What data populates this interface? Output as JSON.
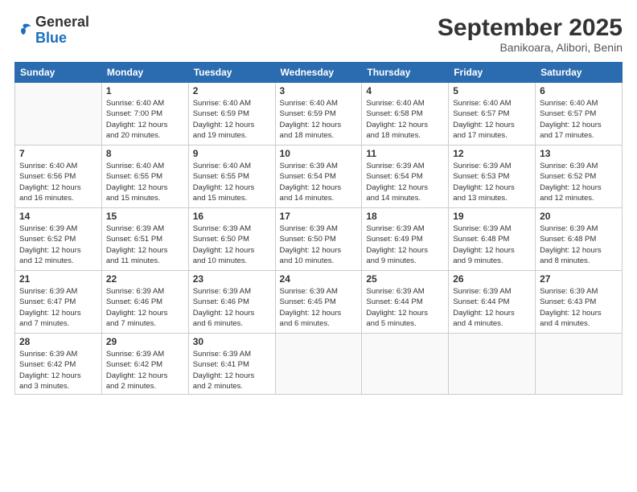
{
  "header": {
    "logo": {
      "line1": "General",
      "line2": "Blue"
    },
    "title": "September 2025",
    "location": "Banikoara, Alibori, Benin"
  },
  "calendar": {
    "days": [
      "Sunday",
      "Monday",
      "Tuesday",
      "Wednesday",
      "Thursday",
      "Friday",
      "Saturday"
    ],
    "weeks": [
      [
        {
          "day": "",
          "text": ""
        },
        {
          "day": "1",
          "text": "Sunrise: 6:40 AM\nSunset: 7:00 PM\nDaylight: 12 hours\nand 20 minutes."
        },
        {
          "day": "2",
          "text": "Sunrise: 6:40 AM\nSunset: 6:59 PM\nDaylight: 12 hours\nand 19 minutes."
        },
        {
          "day": "3",
          "text": "Sunrise: 6:40 AM\nSunset: 6:59 PM\nDaylight: 12 hours\nand 18 minutes."
        },
        {
          "day": "4",
          "text": "Sunrise: 6:40 AM\nSunset: 6:58 PM\nDaylight: 12 hours\nand 18 minutes."
        },
        {
          "day": "5",
          "text": "Sunrise: 6:40 AM\nSunset: 6:57 PM\nDaylight: 12 hours\nand 17 minutes."
        },
        {
          "day": "6",
          "text": "Sunrise: 6:40 AM\nSunset: 6:57 PM\nDaylight: 12 hours\nand 17 minutes."
        }
      ],
      [
        {
          "day": "7",
          "text": "Sunrise: 6:40 AM\nSunset: 6:56 PM\nDaylight: 12 hours\nand 16 minutes."
        },
        {
          "day": "8",
          "text": "Sunrise: 6:40 AM\nSunset: 6:55 PM\nDaylight: 12 hours\nand 15 minutes."
        },
        {
          "day": "9",
          "text": "Sunrise: 6:40 AM\nSunset: 6:55 PM\nDaylight: 12 hours\nand 15 minutes."
        },
        {
          "day": "10",
          "text": "Sunrise: 6:39 AM\nSunset: 6:54 PM\nDaylight: 12 hours\nand 14 minutes."
        },
        {
          "day": "11",
          "text": "Sunrise: 6:39 AM\nSunset: 6:54 PM\nDaylight: 12 hours\nand 14 minutes."
        },
        {
          "day": "12",
          "text": "Sunrise: 6:39 AM\nSunset: 6:53 PM\nDaylight: 12 hours\nand 13 minutes."
        },
        {
          "day": "13",
          "text": "Sunrise: 6:39 AM\nSunset: 6:52 PM\nDaylight: 12 hours\nand 12 minutes."
        }
      ],
      [
        {
          "day": "14",
          "text": "Sunrise: 6:39 AM\nSunset: 6:52 PM\nDaylight: 12 hours\nand 12 minutes."
        },
        {
          "day": "15",
          "text": "Sunrise: 6:39 AM\nSunset: 6:51 PM\nDaylight: 12 hours\nand 11 minutes."
        },
        {
          "day": "16",
          "text": "Sunrise: 6:39 AM\nSunset: 6:50 PM\nDaylight: 12 hours\nand 10 minutes."
        },
        {
          "day": "17",
          "text": "Sunrise: 6:39 AM\nSunset: 6:50 PM\nDaylight: 12 hours\nand 10 minutes."
        },
        {
          "day": "18",
          "text": "Sunrise: 6:39 AM\nSunset: 6:49 PM\nDaylight: 12 hours\nand 9 minutes."
        },
        {
          "day": "19",
          "text": "Sunrise: 6:39 AM\nSunset: 6:48 PM\nDaylight: 12 hours\nand 9 minutes."
        },
        {
          "day": "20",
          "text": "Sunrise: 6:39 AM\nSunset: 6:48 PM\nDaylight: 12 hours\nand 8 minutes."
        }
      ],
      [
        {
          "day": "21",
          "text": "Sunrise: 6:39 AM\nSunset: 6:47 PM\nDaylight: 12 hours\nand 7 minutes."
        },
        {
          "day": "22",
          "text": "Sunrise: 6:39 AM\nSunset: 6:46 PM\nDaylight: 12 hours\nand 7 minutes."
        },
        {
          "day": "23",
          "text": "Sunrise: 6:39 AM\nSunset: 6:46 PM\nDaylight: 12 hours\nand 6 minutes."
        },
        {
          "day": "24",
          "text": "Sunrise: 6:39 AM\nSunset: 6:45 PM\nDaylight: 12 hours\nand 6 minutes."
        },
        {
          "day": "25",
          "text": "Sunrise: 6:39 AM\nSunset: 6:44 PM\nDaylight: 12 hours\nand 5 minutes."
        },
        {
          "day": "26",
          "text": "Sunrise: 6:39 AM\nSunset: 6:44 PM\nDaylight: 12 hours\nand 4 minutes."
        },
        {
          "day": "27",
          "text": "Sunrise: 6:39 AM\nSunset: 6:43 PM\nDaylight: 12 hours\nand 4 minutes."
        }
      ],
      [
        {
          "day": "28",
          "text": "Sunrise: 6:39 AM\nSunset: 6:42 PM\nDaylight: 12 hours\nand 3 minutes."
        },
        {
          "day": "29",
          "text": "Sunrise: 6:39 AM\nSunset: 6:42 PM\nDaylight: 12 hours\nand 2 minutes."
        },
        {
          "day": "30",
          "text": "Sunrise: 6:39 AM\nSunset: 6:41 PM\nDaylight: 12 hours\nand 2 minutes."
        },
        {
          "day": "",
          "text": ""
        },
        {
          "day": "",
          "text": ""
        },
        {
          "day": "",
          "text": ""
        },
        {
          "day": "",
          "text": ""
        }
      ]
    ]
  }
}
